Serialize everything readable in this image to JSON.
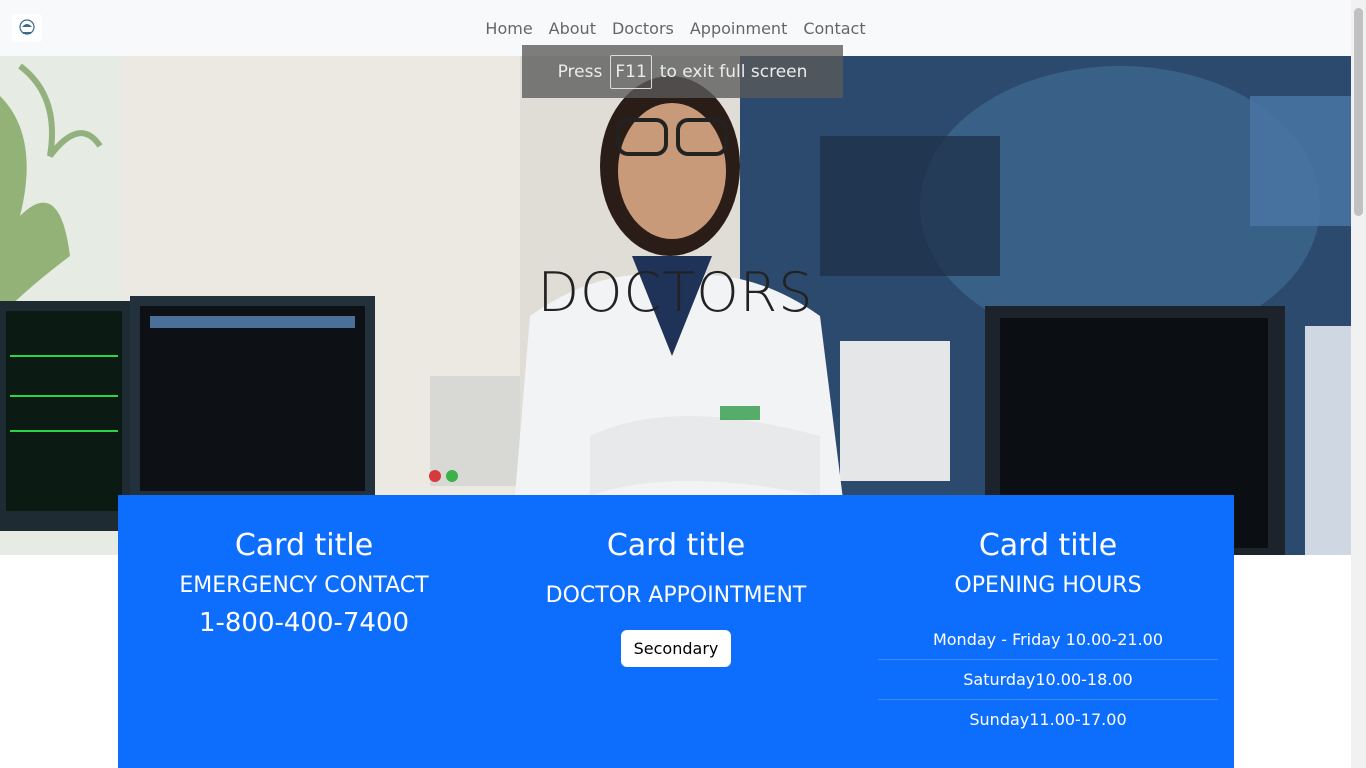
{
  "nav": {
    "brand_icon": "hospital-logo-icon",
    "links": [
      "Home",
      "About",
      "Doctors",
      "Appoinment",
      "Contact"
    ]
  },
  "fullscreen_toast": {
    "press": "Press",
    "key": "F11",
    "rest": "to exit full screen"
  },
  "hero": {
    "title": "DOCTORS"
  },
  "cards": [
    {
      "title": "Card title",
      "subtitle": "EMERGENCY CONTACT",
      "phone": "1-800-400-7400"
    },
    {
      "title": "Card title",
      "subtitle": "DOCTOR APPOINTMENT",
      "button": "Secondary"
    },
    {
      "title": "Card title",
      "subtitle": "OPENING HOURS",
      "hours": [
        "Monday - Friday 10.00-21.00",
        "Saturday10.00-18.00",
        "Sunday11.00-17.00"
      ]
    }
  ],
  "colors": {
    "primary": "#0d6efd",
    "navbar_bg": "#f8f9fa"
  }
}
